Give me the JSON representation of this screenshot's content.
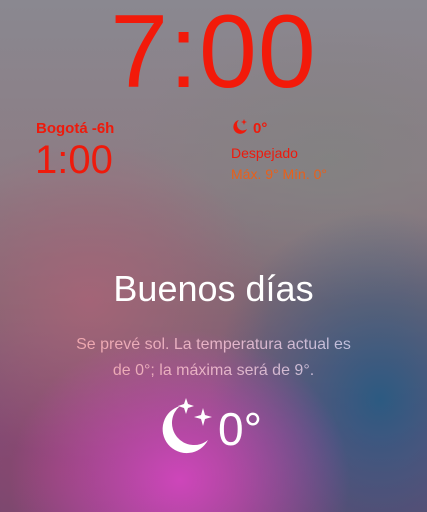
{
  "clock": {
    "time": "7:00"
  },
  "world_clock": {
    "city": "Bogotá -6h",
    "time": "1:00"
  },
  "weather_widget": {
    "icon": "moon-stars-icon",
    "temp": "0°",
    "condition": "Despejado",
    "range": "Máx. 9° Mín. 0°"
  },
  "greeting": {
    "title": "Buenos días",
    "forecast_line1": "Se prevé sol. La temperatura actual es",
    "forecast_line2": "de 0°; la máxima será de 9°.",
    "icon": "moon-stars-icon",
    "temp": "0°"
  },
  "colors": {
    "accent_red": "#f21a0a",
    "range_orange": "#e8601a",
    "text_white": "#ffffff"
  }
}
